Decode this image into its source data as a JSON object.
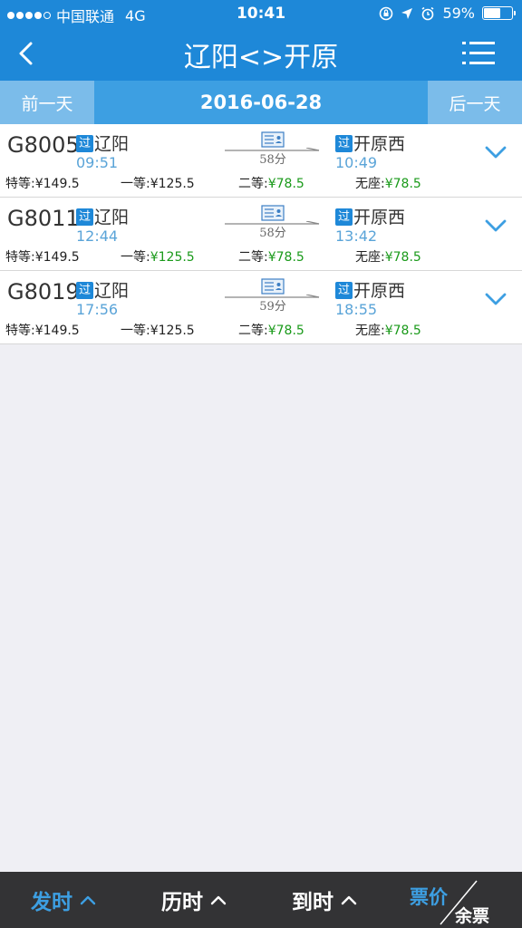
{
  "status": {
    "carrier": "中国联通",
    "network": "4G",
    "time": "10:41",
    "battery": "59%",
    "battery_level": 0.59
  },
  "nav": {
    "title": "辽阳<>开原"
  },
  "datebar": {
    "prev": "前一天",
    "date": "2016-06-28",
    "next": "后一天"
  },
  "trains": [
    {
      "number": "G8005",
      "pass_badge": "过",
      "from": "辽阳",
      "depart": "09:51",
      "duration": "58分",
      "to_badge": "过",
      "to": "开原西",
      "arrive": "10:49",
      "prices": [
        {
          "label": "特等:",
          "value": "¥149.5"
        },
        {
          "label": "一等:",
          "value": "¥125.5"
        },
        {
          "label": "二等:",
          "value": "¥78.5"
        },
        {
          "label": "无座:",
          "value": "¥78.5"
        }
      ]
    },
    {
      "number": "G8011",
      "pass_badge": "过",
      "from": "辽阳",
      "depart": "12:44",
      "duration": "58分",
      "to_badge": "过",
      "to": "开原西",
      "arrive": "13:42",
      "prices": [
        {
          "label": "特等:",
          "value": "¥149.5"
        },
        {
          "label": "一等:",
          "value": "¥125.5"
        },
        {
          "label": "二等:",
          "value": "¥78.5"
        },
        {
          "label": "无座:",
          "value": "¥78.5"
        }
      ]
    },
    {
      "number": "G8019",
      "pass_badge": "过",
      "from": "辽阳",
      "depart": "17:56",
      "duration": "59分",
      "to_badge": "过",
      "to": "开原西",
      "arrive": "18:55",
      "prices": [
        {
          "label": "特等:",
          "value": "¥149.5"
        },
        {
          "label": "一等:",
          "value": "¥125.5"
        },
        {
          "label": "二等:",
          "value": "¥78.5"
        },
        {
          "label": "无座:",
          "value": "¥78.5"
        }
      ]
    }
  ],
  "bottom": {
    "sort_depart": "发时",
    "sort_duration": "历时",
    "sort_arrive": "到时",
    "sort_price": "票价",
    "sort_remaining": "余票"
  },
  "colors": {
    "primary": "#1e88d8",
    "available": "#1a9a1a",
    "time": "#5aa4d8",
    "bottom_bg": "#333335"
  }
}
